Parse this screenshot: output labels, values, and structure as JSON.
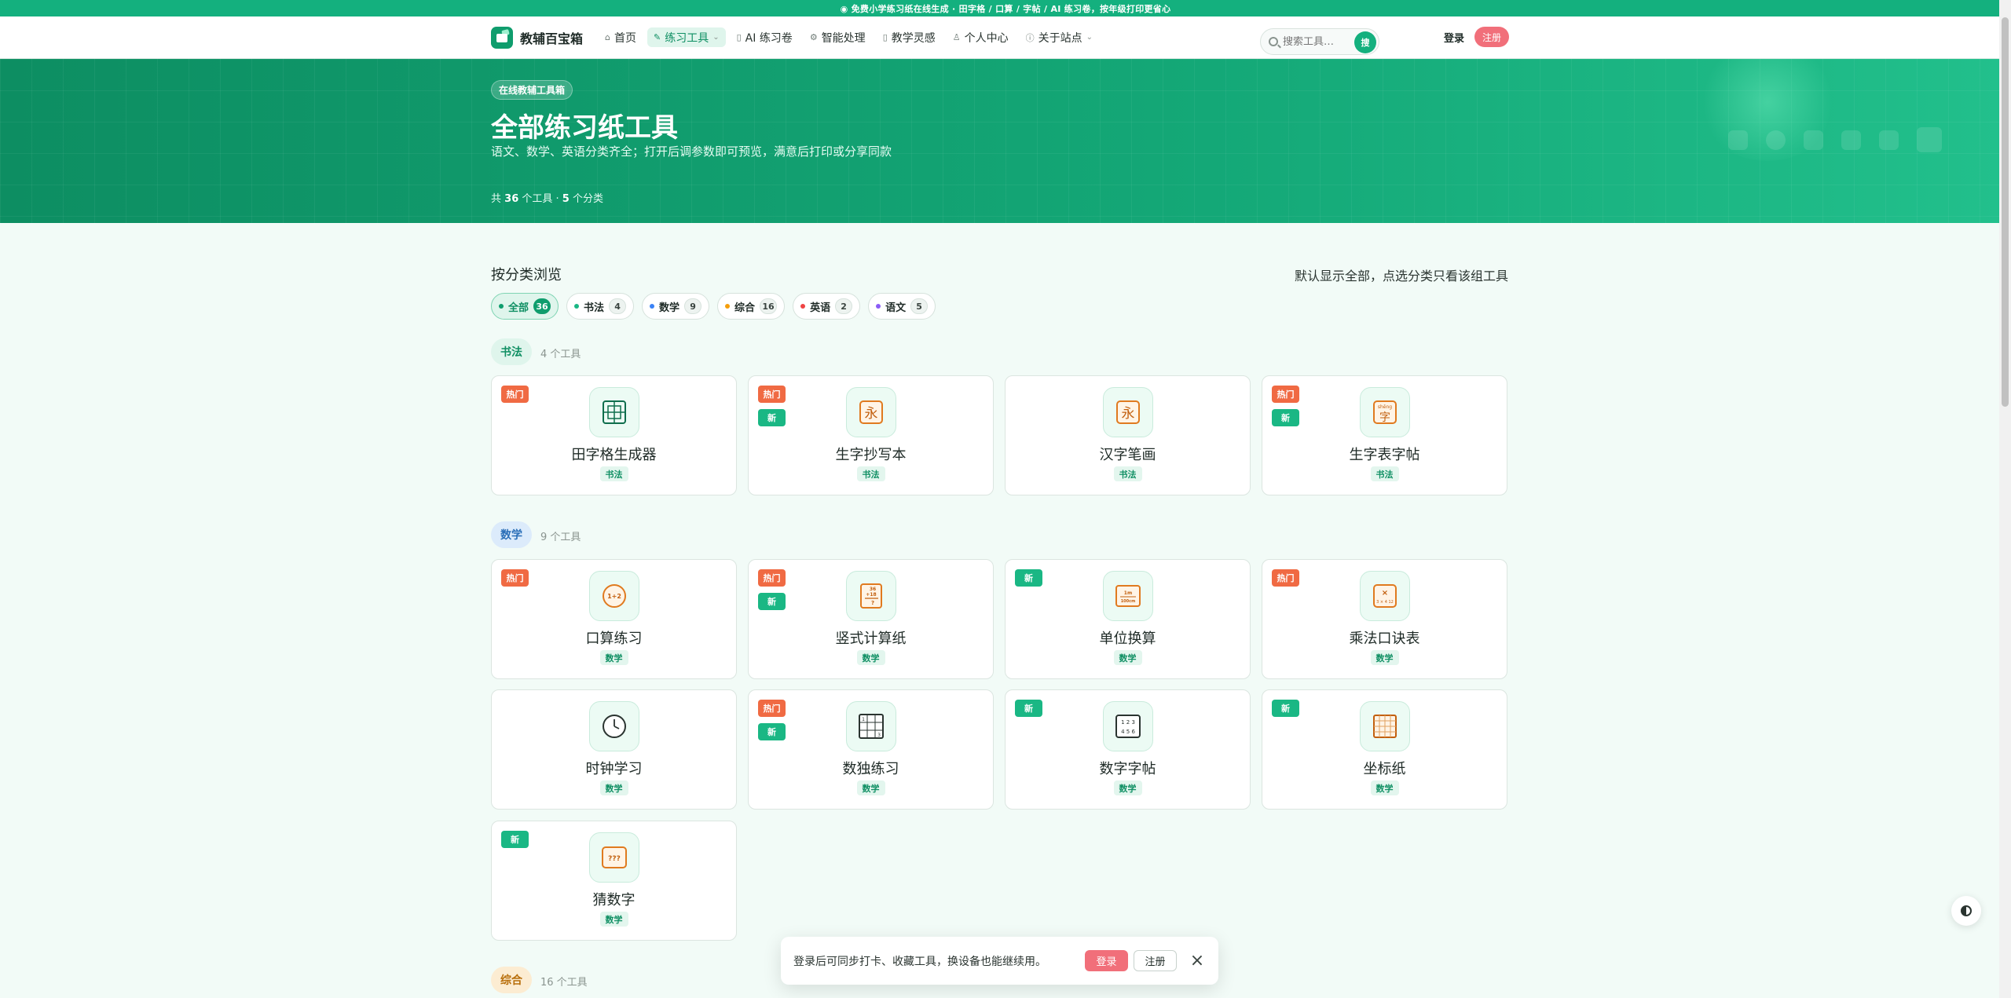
{
  "announcement": "◉ 免费小学练习纸在线生成 · 田字格 / 口算 / 字帖 / AI 练习卷，按年级打印更省心",
  "brand": {
    "name": "教辅百宝箱",
    "accent": "#14b07e"
  },
  "nav": {
    "items": [
      {
        "icon": "home-icon",
        "glyph": "⌂",
        "label": "首页"
      },
      {
        "icon": "wrench-icon",
        "glyph": "✎",
        "label": "练习工具",
        "dropdown": true,
        "active": true
      },
      {
        "icon": "document-icon",
        "glyph": "▯",
        "label": "AI 练习卷"
      },
      {
        "icon": "gear-icon",
        "glyph": "⚙",
        "label": "智能处理"
      },
      {
        "icon": "book-icon",
        "glyph": "▯",
        "label": "教学灵感"
      },
      {
        "icon": "user-icon",
        "glyph": "♙",
        "label": "个人中心"
      },
      {
        "icon": "info-icon",
        "glyph": "ⓘ",
        "label": "关于站点",
        "dropdown": true
      }
    ],
    "search_placeholder": "搜索工具…",
    "search_button": "搜",
    "login": "登录",
    "register": "注册"
  },
  "hero": {
    "badge": "在线教辅工具箱",
    "title": "全部练习纸工具",
    "subtitle": "语文、数学、英语分类齐全；打开后调参数即可预览，满意后打印或分享同款",
    "count_prefix": "共",
    "tool_count": "36",
    "count_mid": "个工具 ·",
    "category_count": "5",
    "count_suffix": "个分类"
  },
  "browse": {
    "title": "按分类浏览",
    "hint": "默认显示全部，点选分类只看该组工具",
    "chips": [
      {
        "label": "全部",
        "count": "36",
        "color": "#0f9d6d",
        "active": true
      },
      {
        "label": "书法",
        "count": "4",
        "color": "#1ab784"
      },
      {
        "label": "数学",
        "count": "9",
        "color": "#3b82f6"
      },
      {
        "label": "综合",
        "count": "16",
        "color": "#f59e0b"
      },
      {
        "label": "英语",
        "count": "2",
        "color": "#ef4444"
      },
      {
        "label": "语文",
        "count": "5",
        "color": "#8b5cf6"
      }
    ]
  },
  "groups": [
    {
      "tag": "书法",
      "count_label": "4 个工具",
      "tag_bg": "#dff5ec",
      "tag_color": "#0f8f63"
    },
    {
      "tag": "数学",
      "count_label": "9 个工具",
      "tag_bg": "#dcebfb",
      "tag_color": "#2a6fb8"
    },
    {
      "tag": "综合",
      "count_label": "16 个工具",
      "tag_bg": "#fcecd2",
      "tag_color": "#b86e0a"
    }
  ],
  "tools": [
    {
      "name": "田字格生成器",
      "category": "书法",
      "icon": "grid-icon",
      "badges": [
        "热门"
      ]
    },
    {
      "name": "生字抄写本",
      "category": "书法",
      "icon": "yong-char-icon",
      "badges": [
        "热门",
        "新"
      ]
    },
    {
      "name": "汉字笔画",
      "category": "书法",
      "icon": "stroke-char-icon",
      "badges": []
    },
    {
      "name": "生字表字帖",
      "category": "书法",
      "icon": "pinyin-char-icon",
      "badges": [
        "热门",
        "新"
      ]
    },
    {
      "name": "口算练习",
      "category": "数学",
      "icon": "addition-icon",
      "badges": [
        "热门"
      ]
    },
    {
      "name": "竖式计算纸",
      "category": "数学",
      "icon": "vertical-calc-icon",
      "badges": [
        "热门",
        "新"
      ]
    },
    {
      "name": "单位换算",
      "category": "数学",
      "icon": "unit-convert-icon",
      "badges": [
        "新"
      ]
    },
    {
      "name": "乘法口诀表",
      "category": "数学",
      "icon": "multiply-icon",
      "badges": [
        "热门"
      ]
    },
    {
      "name": "时钟学习",
      "category": "数学",
      "icon": "clock-icon",
      "badges": []
    },
    {
      "name": "数独练习",
      "category": "数学",
      "icon": "sudoku-icon",
      "badges": [
        "热门",
        "新"
      ]
    },
    {
      "name": "数字字帖",
      "category": "数学",
      "icon": "number-copybook-icon",
      "badges": [
        "新"
      ]
    },
    {
      "name": "坐标纸",
      "category": "数学",
      "icon": "graph-paper-icon",
      "badges": [
        "新"
      ]
    },
    {
      "name": "猜数字",
      "category": "数学",
      "icon": "guess-number-icon",
      "badges": [
        "新"
      ]
    }
  ],
  "icon_text": {
    "yong": "永",
    "zi": "字",
    "zi_pinyin": "shēng",
    "add": "1+2",
    "vcalc_top": "36",
    "vcalc_mid": "+18",
    "vcalc_bot": "?",
    "unit_top": "1m",
    "unit_bot": "100cm",
    "mul_top": "×",
    "mul_bot": "3 × 4 12",
    "sudoku_a": "1",
    "sudoku_b": "3",
    "num_row1": "1 2 3",
    "num_row2": "4 5 6",
    "guess": "???"
  },
  "toast": {
    "message": "登录后可同步打卡、收藏工具，换设备也能继续用。",
    "login": "登录",
    "register": "注册",
    "close_icon": "close-icon"
  }
}
